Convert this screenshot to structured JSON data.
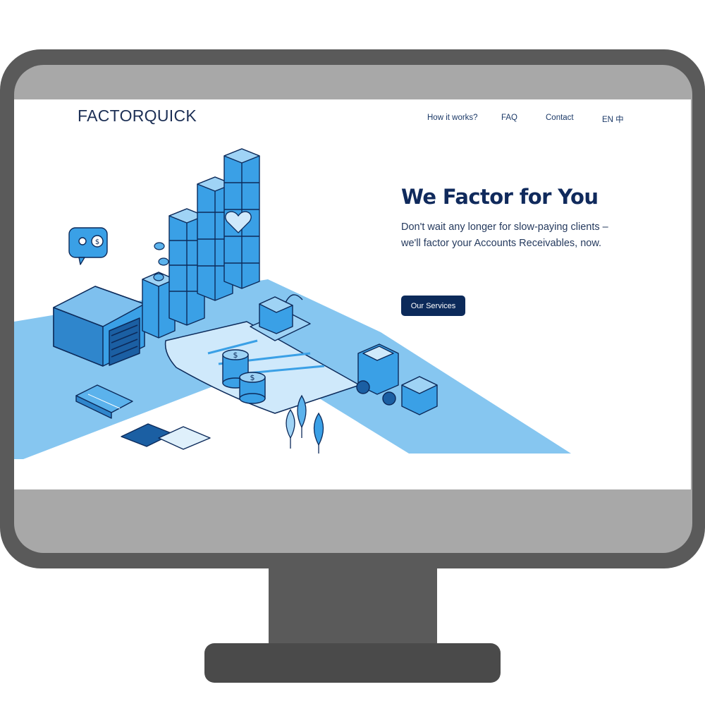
{
  "site": {
    "logo": "FACTORQUICK"
  },
  "nav": {
    "how_it_works": "How it works?",
    "faq": "FAQ",
    "contact": "Contact",
    "language": "EN 中"
  },
  "hero": {
    "title": "We Factor for You",
    "subtitle_line1": "Don't wait any longer for slow-paying clients –",
    "subtitle_line2": "we'll factor your Accounts Receivables, now.",
    "cta_label": "Our Services"
  },
  "illustration": {
    "icons": [
      "warehouse-icon",
      "box-stack-icon",
      "coin-stack-icon",
      "forklift-icon",
      "calculator-icon",
      "puzzle-icon",
      "tree-icon",
      "chat-bubble-icon",
      "heart-icon"
    ]
  },
  "colors": {
    "brand_navy": "#0c2a5a",
    "illustration_blue": "#3aa0e6",
    "illustration_light": "#86c6f0",
    "monitor_frame": "#5a5a5a",
    "screen_bezel": "#a8a8a8"
  }
}
